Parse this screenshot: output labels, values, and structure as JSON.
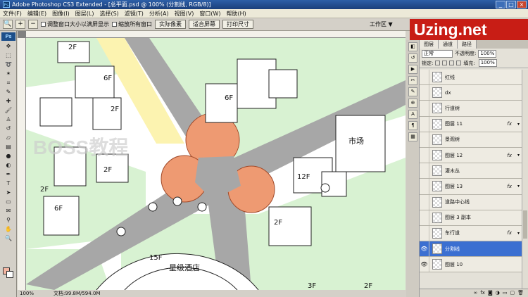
{
  "titlebar": {
    "text": "Adobe Photoshop CS3 Extended - [总平面.psd @ 100% (分割线, RGB/8)]",
    "app_icon": "ps-icon",
    "buttons": [
      "_",
      "□",
      "×"
    ]
  },
  "menu": [
    "文件(F)",
    "编辑(E)",
    "图像(I)",
    "图层(L)",
    "选择(S)",
    "滤镜(T)",
    "分析(A)",
    "视图(V)",
    "窗口(W)",
    "帮助(H)"
  ],
  "options": {
    "resize_windows": "调整窗口大小以满屏显示",
    "zoom_all": "缩放所有窗口",
    "actual_pixels": "实际像素",
    "fit_screen": "适合屏幕",
    "print_size": "打印尺寸",
    "workspace": "工作区 ▼"
  },
  "logo": "Uzing.net",
  "statusbar": {
    "zoom": "100%",
    "doc": "文档:99.8M/594.0M"
  },
  "map": {
    "labels": {
      "a": "2F",
      "b": "6F",
      "c": "2F",
      "d": "6F",
      "e": "2F",
      "f": "2F",
      "g": "6F",
      "h": "12F",
      "i": "2F",
      "j": "15F",
      "k": "3F",
      "l": "2F"
    },
    "market": "市场",
    "hotel": "星级酒店",
    "watermark": "BOSS教程"
  },
  "layers_panel": {
    "tabs": [
      "图层",
      "通道",
      "路径"
    ],
    "blend_mode": "正常",
    "opacity_label": "不透明度:",
    "opacity": "100%",
    "lock_label": "锁定:",
    "fill_label": "填充:",
    "fill": "100%",
    "fx_label": "fx",
    "items": [
      {
        "name": "红线",
        "visible": false,
        "fx": false,
        "selected": false
      },
      {
        "name": "dx",
        "visible": false,
        "fx": false,
        "selected": false
      },
      {
        "name": "行道树",
        "visible": false,
        "fx": false,
        "selected": false
      },
      {
        "name": "图层 11",
        "visible": false,
        "fx": true,
        "selected": false
      },
      {
        "name": "景观树",
        "visible": false,
        "fx": false,
        "selected": false
      },
      {
        "name": "图层 12",
        "visible": false,
        "fx": true,
        "selected": false
      },
      {
        "name": "灌木丛",
        "visible": false,
        "fx": false,
        "selected": false
      },
      {
        "name": "图层 13",
        "visible": false,
        "fx": true,
        "selected": false
      },
      {
        "name": "道路中心线",
        "visible": false,
        "fx": false,
        "selected": false
      },
      {
        "name": "图层 3 副本",
        "visible": false,
        "fx": false,
        "selected": false
      },
      {
        "name": "车行道",
        "visible": false,
        "fx": true,
        "selected": false
      },
      {
        "name": "分割线",
        "visible": true,
        "fx": false,
        "selected": true
      },
      {
        "name": "图层 10",
        "visible": true,
        "fx": false,
        "selected": false
      }
    ],
    "footer_icons": [
      "link-icon",
      "fx-icon",
      "mask-icon",
      "adjust-icon",
      "folder-icon",
      "new-layer-icon",
      "trash-icon"
    ]
  }
}
